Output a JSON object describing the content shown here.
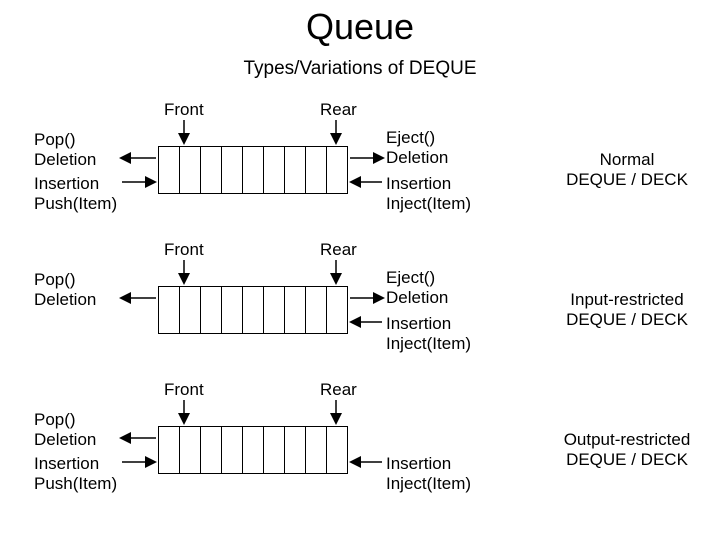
{
  "title": "Queue",
  "subtitle": "Types/Variations of DEQUE",
  "front": "Front",
  "rear": "Rear",
  "left_pop": "Pop()\nDeletion",
  "left_push": "Insertion\nPush(Item)",
  "right_eject": "Eject()\nDeletion",
  "right_inject": "Insertion\nInject(Item)",
  "type_normal": "Normal\nDEQUE / DECK",
  "type_input": "Input-restricted\nDEQUE / DECK",
  "type_output": "Output-restricted\nDEQUE / DECK"
}
